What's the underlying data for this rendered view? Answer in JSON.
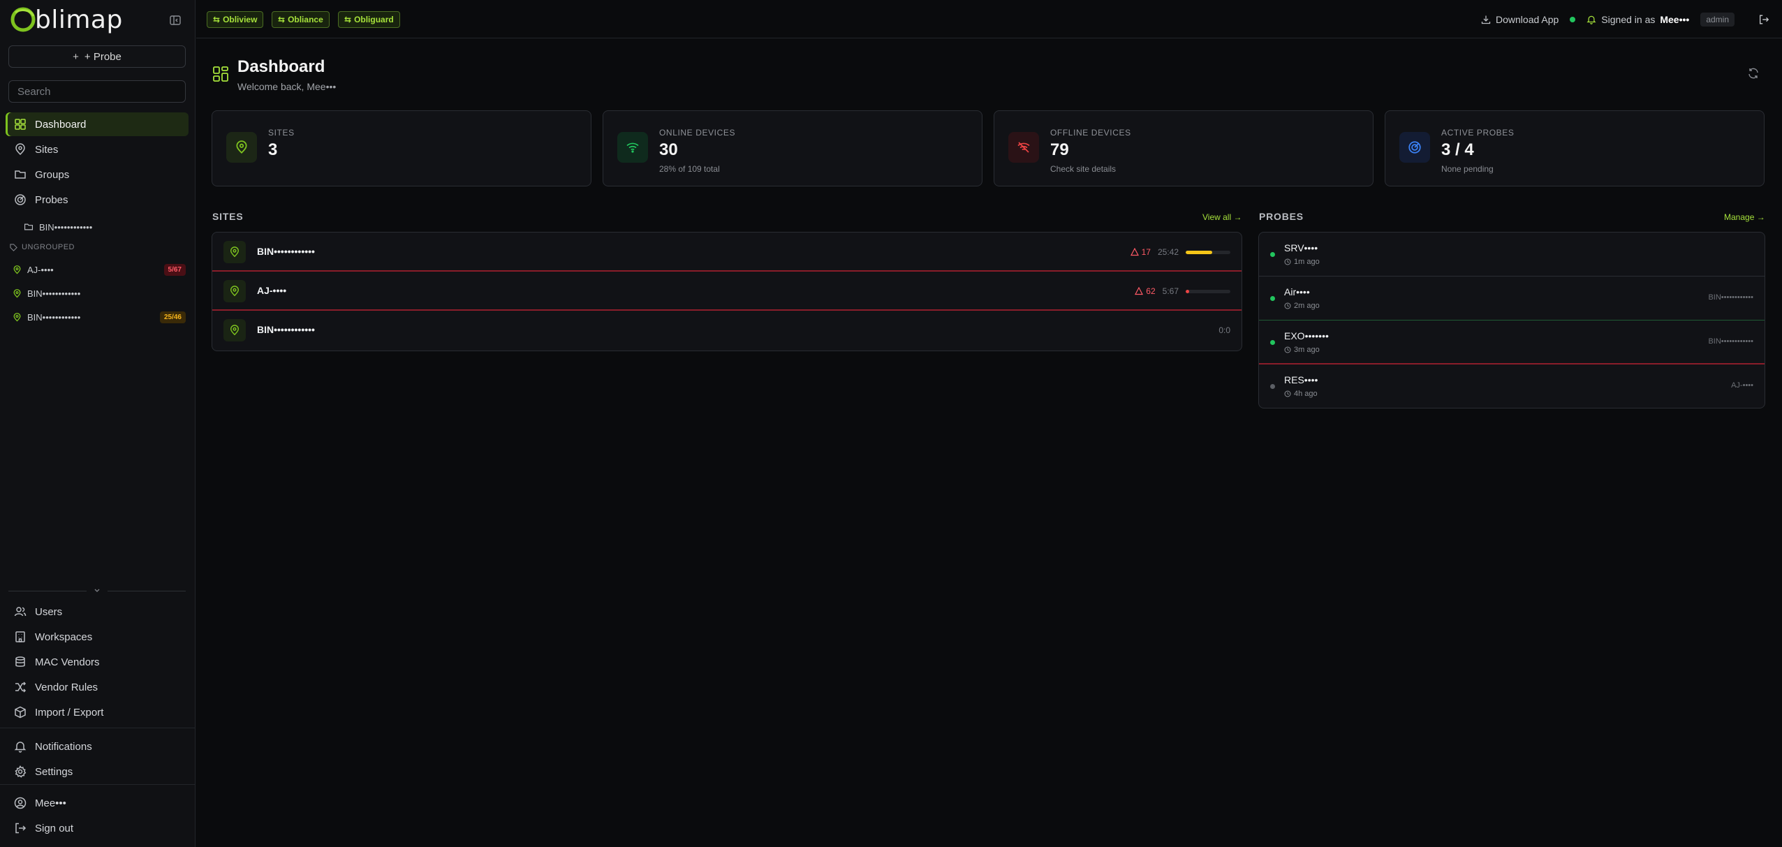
{
  "brand": {
    "logo_text": "blimap"
  },
  "sidebar": {
    "probe_button": "+ Probe",
    "search_placeholder": "Search",
    "nav": [
      {
        "label": "Dashboard",
        "icon": "dashboard-icon",
        "active": true
      },
      {
        "label": "Sites",
        "icon": "map-pin-icon"
      },
      {
        "label": "Groups",
        "icon": "folder-icon"
      },
      {
        "label": "Probes",
        "icon": "radar-icon"
      }
    ],
    "group_item": "BIN••••••••••••",
    "ungrouped_label": "UNGROUPED",
    "ungrouped": [
      {
        "name": "AJ-••••",
        "badge": "5/67",
        "badge_color": "red"
      },
      {
        "name": "BIN••••••••••••",
        "badge": ""
      },
      {
        "name": "BIN••••••••••••",
        "badge": "25/46",
        "badge_color": "amber"
      }
    ],
    "admin_nav": [
      {
        "label": "Users",
        "icon": "users-icon"
      },
      {
        "label": "Workspaces",
        "icon": "building-icon"
      },
      {
        "label": "MAC Vendors",
        "icon": "database-icon"
      },
      {
        "label": "Vendor Rules",
        "icon": "shuffle-icon"
      },
      {
        "label": "Import / Export",
        "icon": "package-icon"
      }
    ],
    "misc_nav": [
      {
        "label": "Notifications",
        "icon": "bell-icon"
      },
      {
        "label": "Settings",
        "icon": "gear-icon"
      }
    ],
    "user_nav": [
      {
        "label": "Mee•••",
        "icon": "user-circle-icon"
      },
      {
        "label": "Sign out",
        "icon": "logout-icon"
      }
    ]
  },
  "topbar": {
    "apps": [
      "Obliview",
      "Obliance",
      "Obliguard"
    ],
    "download_app": "Download App",
    "signed_in_prefix": "Signed in as",
    "username": "Mee•••",
    "role": "admin"
  },
  "page": {
    "title": "Dashboard",
    "subtitle": "Welcome back, Mee•••"
  },
  "stats": [
    {
      "label": "SITES",
      "value": "3",
      "sub": "",
      "icon": "map-pin-icon",
      "color": "#7ec31f"
    },
    {
      "label": "ONLINE DEVICES",
      "value": "30",
      "sub": "28% of 109 total",
      "icon": "wifi-icon",
      "color": "#22c55e"
    },
    {
      "label": "OFFLINE DEVICES",
      "value": "79",
      "sub": "Check site details",
      "icon": "wifi-off-icon",
      "color": "#ef4444"
    },
    {
      "label": "ACTIVE PROBES",
      "value": "3 / 4",
      "sub": "None pending",
      "icon": "radar-icon",
      "color": "#3b82f6"
    }
  ],
  "sites_section": {
    "title": "SITES",
    "link": "View all →",
    "rows": [
      {
        "name": "BIN••••••••••••",
        "alerts": "17",
        "ratio": "25:42",
        "fill": 0.6,
        "bar_color": "#f5c518"
      },
      {
        "name": "AJ-••••",
        "alerts": "62",
        "ratio": "5:67",
        "fill": 0.075,
        "bar_color": "#ef4444"
      },
      {
        "name": "BIN••••••••••••",
        "alerts": "",
        "ratio": "0:0",
        "fill": 0,
        "bar_color": ""
      }
    ]
  },
  "probes_section": {
    "title": "PROBES",
    "link": "Manage →",
    "rows": [
      {
        "name": "SRV••••",
        "time": "1m ago",
        "site": "",
        "status": "online"
      },
      {
        "name": "Air••••",
        "time": "2m ago",
        "site": "BIN••••••••••••",
        "status": "online"
      },
      {
        "name": "EXO•••••••",
        "time": "3m ago",
        "site": "BIN••••••••••••",
        "status": "online"
      },
      {
        "name": "RES••••",
        "time": "4h ago",
        "site": "AJ-••••",
        "status": "offline"
      }
    ]
  }
}
